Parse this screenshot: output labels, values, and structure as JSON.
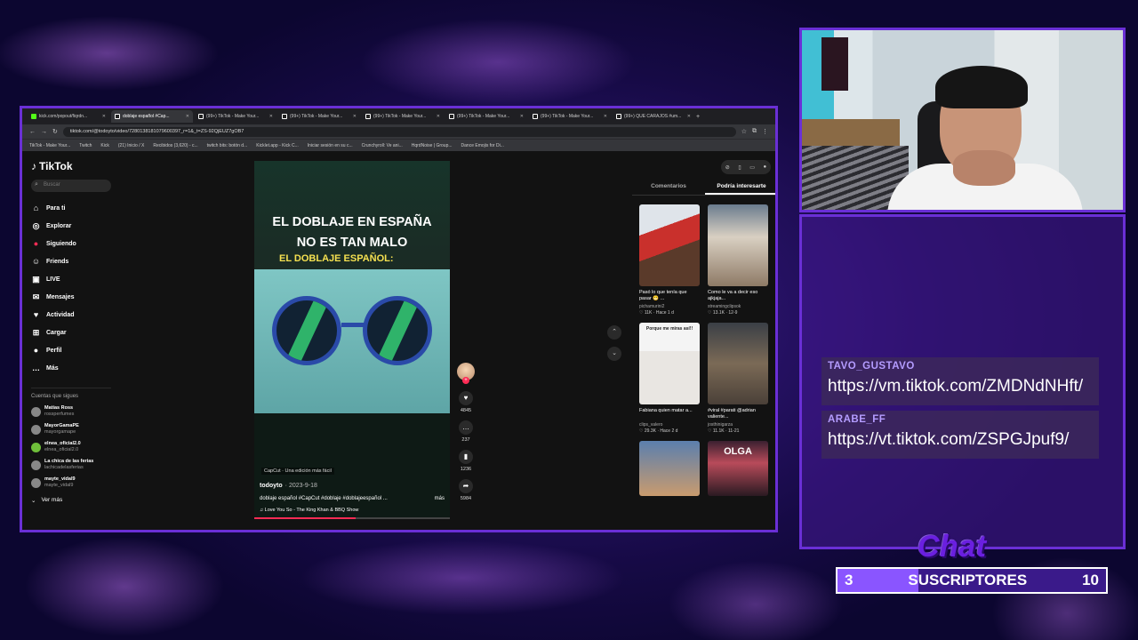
{
  "browser": {
    "tabs": [
      {
        "label": "kick.com/popout/fiqrdn..."
      },
      {
        "label": "doblaje español #Cap..."
      },
      {
        "label": "(99+) TikTok - Make Your..."
      },
      {
        "label": "(99+) TikTok - Make Your..."
      },
      {
        "label": "(99+) TikTok - Make Your..."
      },
      {
        "label": "(99+) TikTok - Make Your..."
      },
      {
        "label": "(99+) TikTok - Make Your..."
      },
      {
        "label": "(99+) QUE CARAJOS #um..."
      }
    ],
    "url": "tiktok.com/@todoyto/video/7280138181079600397_r=1&_t=ZS-92QjEUZ7gOB7",
    "bookmarks": [
      "TikTok - Make Your...",
      "Twitch",
      "Kick",
      "(21) Inicio / X",
      "Recibidos (3,620) - c...",
      "twitch bits: botón d...",
      "Kicklet.app - Kick C...",
      "Iniciar sesión en su c...",
      "Crunchyroll: Ve ani...",
      "HqrdNoise | Group...",
      "Dance Emojis for Di..."
    ]
  },
  "tiktok": {
    "logo": "TikTok",
    "search_placeholder": "Buscar",
    "menu": [
      {
        "label": "Para ti",
        "icon": "home-icon"
      },
      {
        "label": "Explorar",
        "icon": "compass-icon"
      },
      {
        "label": "Siguiendo",
        "icon": "following-icon"
      },
      {
        "label": "Friends",
        "icon": "friends-icon"
      },
      {
        "label": "LIVE",
        "icon": "live-icon"
      },
      {
        "label": "Mensajes",
        "icon": "messages-icon"
      },
      {
        "label": "Actividad",
        "icon": "activity-icon"
      },
      {
        "label": "Cargar",
        "icon": "upload-icon"
      },
      {
        "label": "Perfil",
        "icon": "profile-icon"
      },
      {
        "label": "Más",
        "icon": "more-icon"
      }
    ],
    "following_title": "Cuentas que sigues",
    "following": [
      {
        "name": "Matías Ross",
        "handle": "rossperfumes"
      },
      {
        "name": "MayorGamaPE",
        "handle": "mayorgamape"
      },
      {
        "name": "elnea_oficial2.0",
        "handle": "elnea_oficial2.0"
      },
      {
        "name": "La chica de las ferias",
        "handle": "lachicadelasferias"
      },
      {
        "name": "mayte_vidal9",
        "handle": "mayte_vidal9"
      }
    ],
    "see_more": "Ver más",
    "video": {
      "title_line1": "EL DOBLAJE EN ESPAÑA",
      "title_line2": "NO ES TAN MALO",
      "subtitle": "EL DOBLAJE ESPAÑOL:",
      "capcut": "CapCut · Una edición más fácil",
      "author": "todoyto",
      "date": "· 2023-9-18",
      "description": "doblaje español #CapCut #doblaje #doblajeespañol ...",
      "more": "más",
      "music": "Love You So - The King Khan & BBQ Show",
      "progress": 0.52
    },
    "actions": [
      {
        "icon": "heart-icon",
        "count": "4845"
      },
      {
        "icon": "comment-icon",
        "count": "237"
      },
      {
        "icon": "bookmark-icon",
        "count": "1236"
      },
      {
        "icon": "share-icon",
        "count": "5984"
      }
    ],
    "right_tabs": [
      "Comentarios",
      "Podría interesarte"
    ],
    "recommended": [
      {
        "caption": "Pasó lo que tenía que pasar 😬 ...",
        "user": "pichamurini2",
        "stats": "♡ 11K · Hace 1 d",
        "overlay": ""
      },
      {
        "caption": "Como le va a decir eso ajkjaja...",
        "user": "streamingclipsok",
        "stats": "♡ 13.1K · 12-9",
        "overlay": ""
      },
      {
        "caption": "Fabiana quien matar a...",
        "user": "clips_valero",
        "stats": "♡ 29.3K · Hace 2 d",
        "overlay": "Porque me miras así!!"
      },
      {
        "caption": "#viral #parati @adrian valiente...",
        "user": "josthinigarza",
        "stats": "♡ 11.1K · 11-21",
        "overlay": ""
      },
      {
        "caption": "",
        "user": "",
        "stats": "",
        "overlay": ""
      },
      {
        "caption": "",
        "user": "",
        "stats": "",
        "overlay": "OLGA"
      }
    ]
  },
  "chat": {
    "messages": [
      {
        "user": "TAVO_GUSTAVO",
        "text": "https://vm.tiktok.com/ZMDNdNHft/"
      },
      {
        "user": "ARABE_FF",
        "text": "https://vt.tiktok.com/ZSPGJpuf9/"
      }
    ],
    "title": "Chat"
  },
  "subgoal": {
    "current": "3",
    "label": "SUSCRIPTORES",
    "goal": "10",
    "progress": 0.3
  }
}
